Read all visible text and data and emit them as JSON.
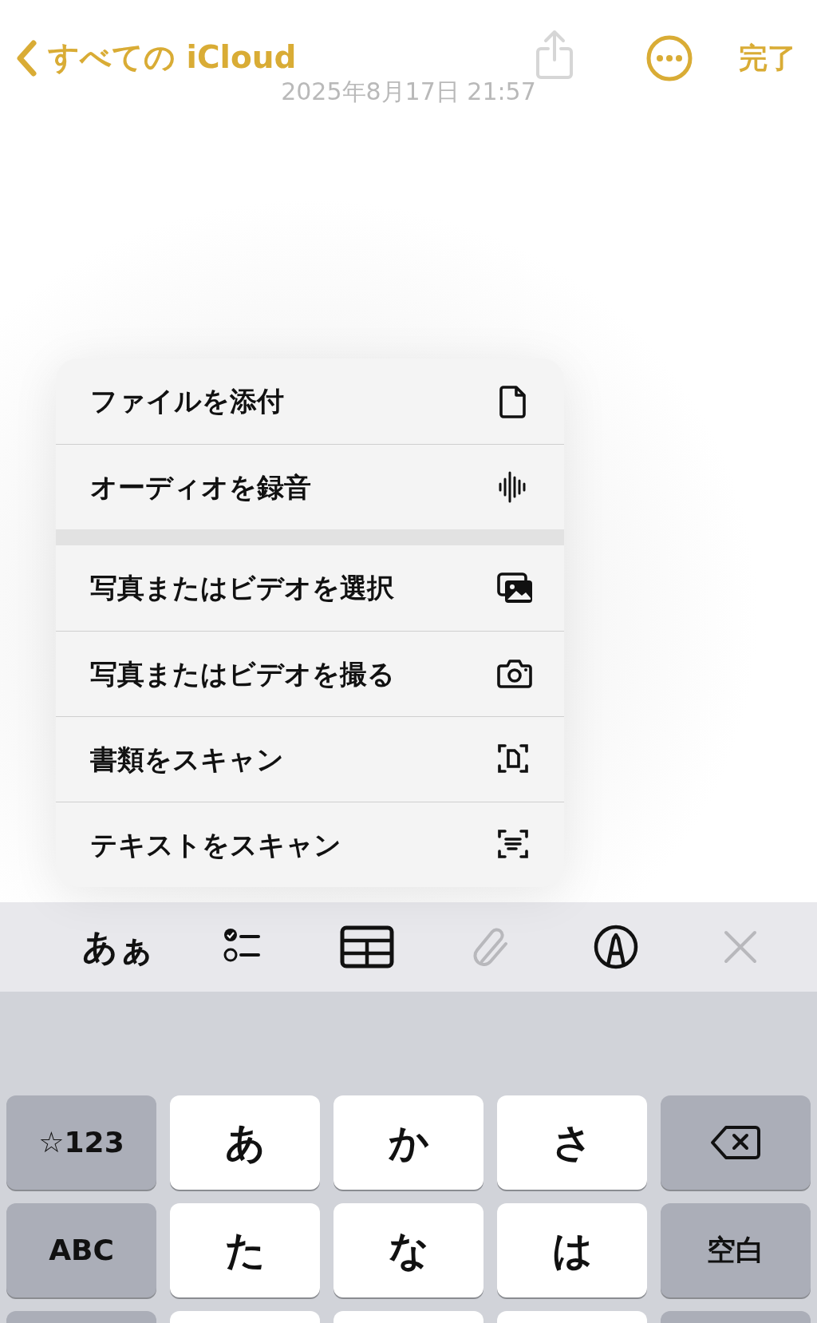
{
  "nav": {
    "back_label": "すべての iCloud",
    "share_disabled": true,
    "done_label": "完了"
  },
  "note": {
    "date": "2025年8月17日 21:57"
  },
  "menu": {
    "groups": [
      [
        {
          "label": "ファイルを添付"
        },
        {
          "label": "オーディオを録音"
        }
      ],
      [
        {
          "label": "写真またはビデオを選択"
        },
        {
          "label": "写真またはビデオを撮る"
        },
        {
          "label": "書類をスキャン"
        },
        {
          "label": "テキストをスキャン"
        }
      ]
    ]
  },
  "toolbar": [
    {
      "kind": "text",
      "label": "あぁ",
      "disabled": false
    },
    {
      "kind": "icon",
      "disabled": false
    },
    {
      "kind": "icon",
      "disabled": false
    },
    {
      "kind": "icon",
      "disabled": true
    },
    {
      "kind": "icon",
      "disabled": false
    },
    {
      "kind": "icon",
      "disabled": true
    }
  ],
  "keyboard": {
    "rows": [
      [
        {
          "kind": "function",
          "label": "☆123"
        },
        {
          "kind": "letter",
          "label": "あ"
        },
        {
          "kind": "letter",
          "label": "か"
        },
        {
          "kind": "letter",
          "label": "さ"
        },
        {
          "kind": "delete"
        }
      ],
      [
        {
          "kind": "function",
          "label": "ABC"
        },
        {
          "kind": "letter",
          "label": "た"
        },
        {
          "kind": "letter",
          "label": "な"
        },
        {
          "kind": "letter",
          "label": "は"
        },
        {
          "kind": "function",
          "label": "空白"
        }
      ],
      [
        {
          "kind": "function"
        },
        {
          "kind": "letter"
        },
        {
          "kind": "letter"
        },
        {
          "kind": "letter"
        },
        {
          "kind": "function"
        }
      ]
    ]
  }
}
